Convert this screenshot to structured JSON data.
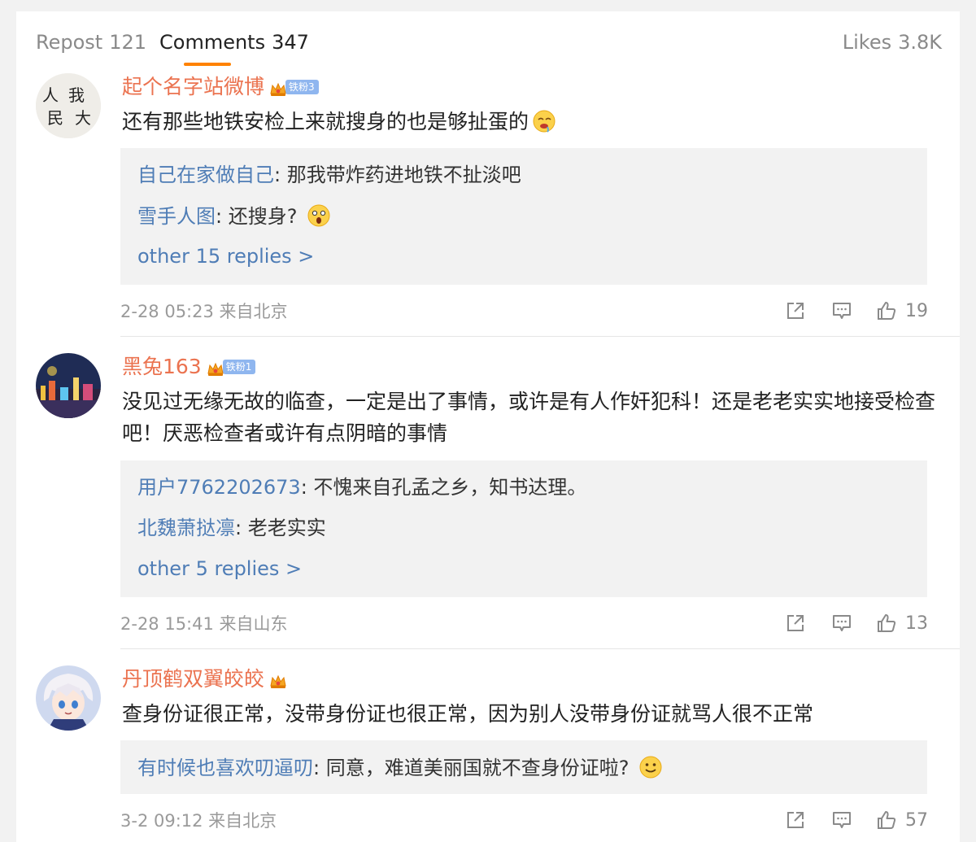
{
  "tabs": {
    "repost_label": "Repost",
    "repost_count": "121",
    "comments_label": "Comments",
    "comments_count": "347",
    "likes_label": "Likes",
    "likes_count": "3.8K"
  },
  "accent_color": "#ff8200",
  "username_color": "#eb7350",
  "link_color": "#4f7db6",
  "comments": [
    {
      "username": "起个名字站微博",
      "fan_badge": "铁粉3",
      "text": "还有那些地铁安检上来就搜身的也是够扯蛋的",
      "text_emoji": "drooling-face-emoji",
      "replies": [
        {
          "name": "自己在家做自己",
          "text": ": 那我带炸药进地铁不扯淡吧"
        },
        {
          "name": "雪手人图",
          "text": ": 还搜身? ",
          "emoji": "shocked-face-emoji"
        }
      ],
      "more_replies": "other 15 replies >",
      "timestamp": "2-28 05:23 来自北京",
      "likes": "19"
    },
    {
      "username": "黑兔163",
      "fan_badge": "铁粉1",
      "text": "没见过无缘无故的临查，一定是出了事情，或许是有人作奸犯科！还是老老实实地接受检查吧！厌恶检查者或许有点阴暗的事情",
      "replies": [
        {
          "name": "用户7762202673",
          "text": ": 不愧来自孔孟之乡，知书达理。"
        },
        {
          "name": "北魏萧挞凛",
          "text": ": 老老实实"
        }
      ],
      "more_replies": "other 5 replies >",
      "timestamp": "2-28 15:41 来自山东",
      "likes": "13"
    },
    {
      "username": "丹顶鹤双翼皎皎",
      "text": "查身份证很正常，没带身份证也很正常，因为别人没带身份证就骂人很不正常",
      "replies": [
        {
          "name": "有时候也喜欢叨逼叨",
          "text": ": 同意，难道美丽国就不查身份证啦? ",
          "emoji": "smile-face-emoji"
        }
      ],
      "timestamp": "3-2 09:12 来自北京",
      "likes": "57"
    }
  ]
}
